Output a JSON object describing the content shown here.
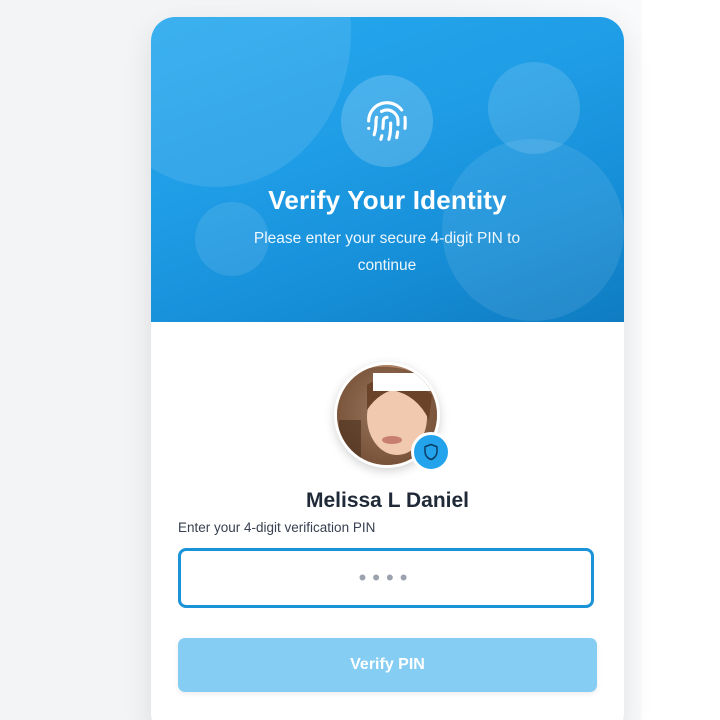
{
  "header": {
    "icon": "fingerprint-icon",
    "title": "Verify Your Identity",
    "subtitle": "Please enter your secure 4-digit PIN to continue"
  },
  "user": {
    "name": "Melissa L Daniel",
    "badge_icon": "shield-icon"
  },
  "pin": {
    "label": "Enter your 4-digit verification PIN",
    "placeholder": "••••",
    "value": ""
  },
  "actions": {
    "verify_label": "Verify PIN"
  },
  "colors": {
    "accent": "#1f9de6",
    "button_disabled": "#86cdf3",
    "input_border": "#1a93d8"
  }
}
